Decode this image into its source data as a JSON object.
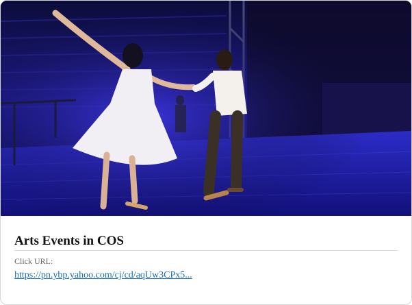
{
  "card": {
    "title": "Arts Events in COS",
    "url_label": "Click URL:",
    "url_text": "https://pn.ybp.yahoo.com/cj/cd/aqUw3CPx5...",
    "link_color": "#1a6fb5"
  },
  "image": {
    "subject": "dance-performance-photo",
    "stage_light_color": "#2a22d0"
  }
}
